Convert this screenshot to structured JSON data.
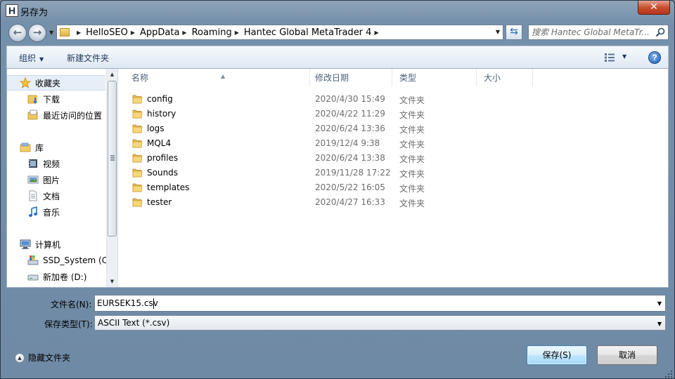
{
  "window": {
    "title": "另存为",
    "app_letter": "H"
  },
  "address": {
    "breadcrumbs": [
      "HelloSEO",
      "AppData",
      "Roaming",
      "Hantec Global MetaTrader 4"
    ]
  },
  "search": {
    "placeholder": "搜索 Hantec Global MetaTr..."
  },
  "toolbar": {
    "organize_label": "组织",
    "new_folder_label": "新建文件夹"
  },
  "nav": {
    "favorites_label": "收藏夹",
    "favorites": [
      "下载",
      "最近访问的位置"
    ],
    "libraries_label": "库",
    "libraries": [
      "视频",
      "图片",
      "文档",
      "音乐"
    ],
    "computer_label": "计算机",
    "drives": [
      "SSD_System (C:",
      "新加卷 (D:)"
    ]
  },
  "columns": {
    "name": "名称",
    "date": "修改日期",
    "type": "类型",
    "size": "大小"
  },
  "files": [
    {
      "name": "config",
      "date": "2020/4/30 15:49",
      "type": "文件夹"
    },
    {
      "name": "history",
      "date": "2020/4/22 11:29",
      "type": "文件夹"
    },
    {
      "name": "logs",
      "date": "2020/6/24 13:36",
      "type": "文件夹"
    },
    {
      "name": "MQL4",
      "date": "2019/12/4 9:38",
      "type": "文件夹"
    },
    {
      "name": "profiles",
      "date": "2020/6/24 13:38",
      "type": "文件夹"
    },
    {
      "name": "Sounds",
      "date": "2019/11/28 17:22",
      "type": "文件夹"
    },
    {
      "name": "templates",
      "date": "2020/5/22 16:05",
      "type": "文件夹"
    },
    {
      "name": "tester",
      "date": "2020/4/27 16:33",
      "type": "文件夹"
    }
  ],
  "form": {
    "filename_label": "文件名(N):",
    "filename_value": "EURSEK15.csv",
    "filetype_label": "保存类型(T):",
    "filetype_value": "ASCII Text (*.csv)"
  },
  "footer": {
    "hide_folders_label": "隐藏文件夹",
    "save_label": "保存(S)",
    "cancel_label": "取消"
  },
  "colors": {
    "accent": "#3c7fb1",
    "folder": "#f0c85a",
    "close": "#c7502f"
  }
}
